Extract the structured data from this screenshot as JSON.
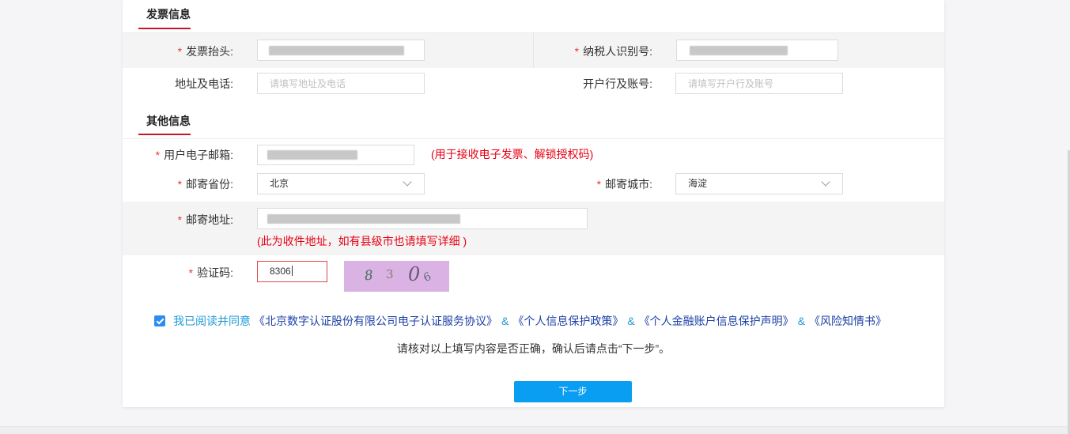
{
  "required_mark": "*",
  "invoice": {
    "title": "发票信息",
    "invoice_title": {
      "label": "发票抬头:"
    },
    "tax_id": {
      "label": "纳税人识别号:"
    },
    "address_phone": {
      "label": "地址及电话:",
      "placeholder": "请填写地址及电话"
    },
    "bank_account": {
      "label": "开户行及账号:",
      "placeholder": "请填写开户行及账号"
    }
  },
  "other": {
    "title": "其他信息",
    "email": {
      "label": "用户电子邮箱:",
      "note": "(用于接收电子发票、解锁授权码)"
    },
    "province": {
      "label": "邮寄省份:",
      "value": "北京",
      "icon": "chevron-down-icon"
    },
    "city": {
      "label": "邮寄城市:",
      "value": "海淀",
      "icon": "chevron-down-icon"
    },
    "address": {
      "label": "邮寄地址:",
      "note": "(此为收件地址，如有县级市也请填写详细 )"
    },
    "captcha": {
      "label": "验证码:",
      "value": "8306",
      "image_chars": [
        "8",
        "3",
        "0",
        "6"
      ]
    }
  },
  "agreement": {
    "checked": true,
    "icon": "check-icon",
    "prefix": "我已阅读并同意",
    "separator": "&",
    "documents": [
      "《北京数字认证股份有限公司电子认证服务协议》",
      "《个人信息保护政策》",
      "《个人金融账户信息保护声明》",
      "《风险知情书》"
    ]
  },
  "confirm_hint": "请核对以上填写内容是否正确，确认后请点击“下一步”。",
  "next_button_label": "下一步",
  "colors": {
    "accent_red": "#c9152b",
    "required_red": "#e0383e",
    "note_red": "#e60012",
    "primary_blue": "#0a9ef2",
    "checkbox_blue": "#2d8cf0",
    "link_blue": "#1d41a6",
    "prefix_blue": "#1f9ad8",
    "error_border": "#e04848"
  }
}
